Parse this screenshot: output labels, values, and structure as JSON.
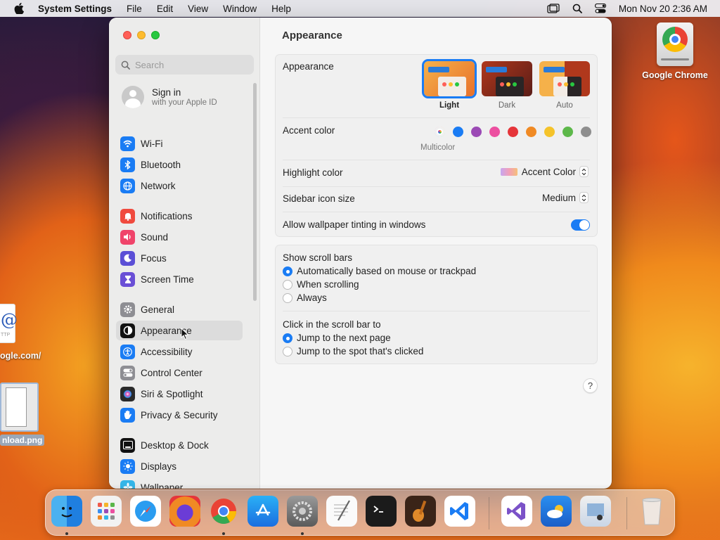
{
  "menubar": {
    "app_name": "System Settings",
    "menus": [
      "File",
      "Edit",
      "View",
      "Window",
      "Help"
    ],
    "clock": "Mon Nov 20  2:36 AM"
  },
  "desktop": {
    "chrome_label": "Google Chrome",
    "file1_label": "ogle.com/",
    "file1_glyph": "@",
    "file1_tag": "TTP",
    "file2_label": "nload.png"
  },
  "sidebar": {
    "search_placeholder": "Search",
    "signin_title": "Sign in",
    "signin_subtitle": "with your Apple ID",
    "items": [
      {
        "label": "Wi-Fi",
        "icon": "wifi-icon",
        "color": "#1a7cf4"
      },
      {
        "label": "Bluetooth",
        "icon": "bluetooth-icon",
        "color": "#1a7cf4"
      },
      {
        "label": "Network",
        "icon": "globe-icon",
        "color": "#1a7cf4"
      },
      {
        "label": "Notifications",
        "icon": "bell-icon",
        "color": "#f04a3e"
      },
      {
        "label": "Sound",
        "icon": "speaker-icon",
        "color": "#f0446a"
      },
      {
        "label": "Focus",
        "icon": "moon-icon",
        "color": "#5b4fd6"
      },
      {
        "label": "Screen Time",
        "icon": "hourglass-icon",
        "color": "#6a4fd6"
      },
      {
        "label": "General",
        "icon": "gear-icon",
        "color": "#8e8e93"
      },
      {
        "label": "Appearance",
        "icon": "appearance-icon",
        "color": "#111111"
      },
      {
        "label": "Accessibility",
        "icon": "accessibility-icon",
        "color": "#1a7cf4"
      },
      {
        "label": "Control Center",
        "icon": "control-center-icon",
        "color": "#8e8e93"
      },
      {
        "label": "Siri & Spotlight",
        "icon": "siri-icon",
        "color": "#2a2a2a"
      },
      {
        "label": "Privacy & Security",
        "icon": "hand-icon",
        "color": "#1a7cf4"
      },
      {
        "label": "Desktop & Dock",
        "icon": "dock-icon",
        "color": "#111111"
      },
      {
        "label": "Displays",
        "icon": "sun-icon",
        "color": "#1a7cf4"
      },
      {
        "label": "Wallpaper",
        "icon": "wallpaper-icon",
        "color": "#35b6e8"
      }
    ],
    "selected": "Appearance"
  },
  "main": {
    "title": "Appearance",
    "appearance_label": "Appearance",
    "themes": [
      {
        "label": "Light",
        "selected": true
      },
      {
        "label": "Dark",
        "selected": false
      },
      {
        "label": "Auto",
        "selected": false
      }
    ],
    "accent_label": "Accent color",
    "accent_colors": [
      "multicolor",
      "#1a7cf4",
      "#9b4ab5",
      "#ec4fa0",
      "#e5353a",
      "#f08a24",
      "#f5c32a",
      "#5db84a",
      "#8e8e8e"
    ],
    "accent_selected_label": "Multicolor",
    "highlight_label": "Highlight color",
    "highlight_value": "Accent Color",
    "sidebar_icon_label": "Sidebar icon size",
    "sidebar_icon_value": "Medium",
    "wallpaper_tint_label": "Allow wallpaper tinting in windows",
    "wallpaper_tint_on": true,
    "scroll_bars_label": "Show scroll bars",
    "scroll_bar_options": [
      "Automatically based on mouse or trackpad",
      "When scrolling",
      "Always"
    ],
    "scroll_bar_selected": 0,
    "click_label": "Click in the scroll bar to",
    "click_options": [
      "Jump to the next page",
      "Jump to the spot that's clicked"
    ],
    "click_selected": 0,
    "help_label": "?"
  },
  "dock": {
    "apps": [
      "finder-icon",
      "launchpad-icon",
      "safari-icon",
      "firefox-icon",
      "chrome-icon",
      "app-store-icon",
      "system-settings-icon",
      "textedit-icon",
      "terminal-icon",
      "garageband-icon",
      "vscode-icon",
      "visual-studio-icon",
      "weather-icon",
      "preview-icon",
      "trash-icon"
    ]
  }
}
